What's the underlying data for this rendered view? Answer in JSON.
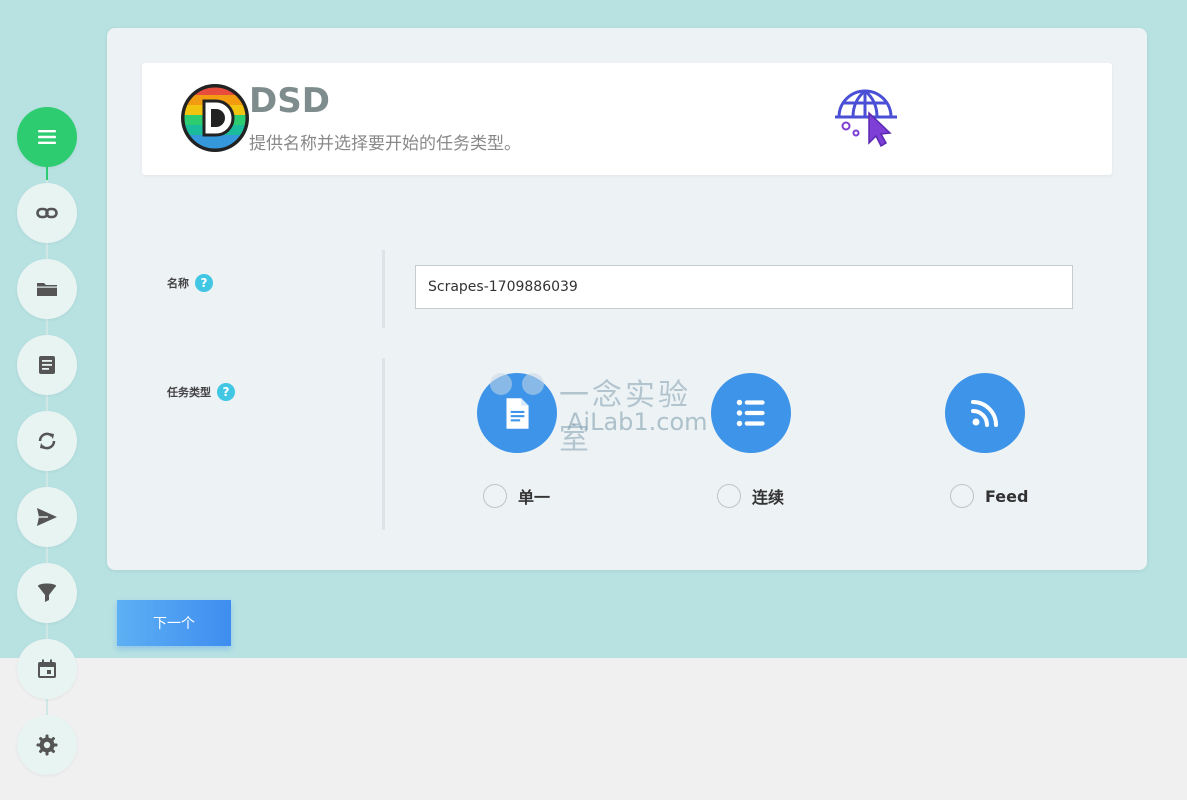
{
  "app": {
    "brand": "DSD",
    "subtitle": "提供名称并选择要开始的任务类型。"
  },
  "sidebar": {
    "steps": [
      {
        "icon": "menu-icon",
        "active": true
      },
      {
        "icon": "link-icon",
        "active": false
      },
      {
        "icon": "folder-icon",
        "active": false
      },
      {
        "icon": "document-icon",
        "active": false
      },
      {
        "icon": "refresh-icon",
        "active": false
      },
      {
        "icon": "send-icon",
        "active": false
      },
      {
        "icon": "filter-icon",
        "active": false
      },
      {
        "icon": "calendar-icon",
        "active": false
      },
      {
        "icon": "settings-icon",
        "active": false
      }
    ]
  },
  "form": {
    "name_label": "名称",
    "name_help": "?",
    "name_value": "Scrapes-1709886039",
    "type_label": "任务类型",
    "type_help": "?",
    "types": [
      {
        "label": "单一",
        "icon": "single-page-icon",
        "selected": false
      },
      {
        "label": "连续",
        "icon": "list-icon",
        "selected": false
      },
      {
        "label": "Feed",
        "icon": "rss-icon",
        "selected": false
      }
    ]
  },
  "watermark": {
    "cn": "一念实验室",
    "en": "AiLab1.com"
  },
  "footer": {
    "next_label": "下一个"
  },
  "colors": {
    "background": "#b8e2e2",
    "active_step": "#2ecc71",
    "type_icon": "#3d94e8",
    "help_badge": "#41c7e4",
    "next_button": "#3e8df0"
  }
}
